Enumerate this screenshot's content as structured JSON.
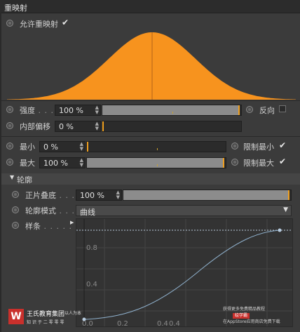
{
  "panel": {
    "title": "重映射"
  },
  "remap": {
    "enable_label": "允许重映射",
    "enabled": true
  },
  "strength": {
    "label": "强度",
    "value": "100 %",
    "fraction": 1.0,
    "invert_label": "反向",
    "inverted": false
  },
  "inner_offset": {
    "label": "内部偏移",
    "value": "0 %",
    "fraction": 0.0
  },
  "min": {
    "label": "最小",
    "value": "0 %",
    "fraction": 0.0,
    "clamp_label": "限制最小",
    "clamp": true
  },
  "max": {
    "label": "最大",
    "value": "100 %",
    "fraction": 1.0,
    "clamp_label": "限制最大",
    "clamp": true
  },
  "contour": {
    "group_label": "轮廓",
    "overlay_label": "正片叠底",
    "overlay_value": "100 %",
    "overlay_fraction": 1.0,
    "mode_label": "轮廓模式",
    "mode_value": "曲线",
    "spline_label": "样条",
    "spline_y_ticks": [
      "0.8",
      "0.4"
    ],
    "spline_x_ticks": [
      "0.0",
      "0.2",
      "0.4"
    ],
    "spline_x_tick2": "0.4"
  },
  "watermark": {
    "brand": "王氏教育集团",
    "brand_small": "以人为本",
    "slogan": "知 识 于 二 零 零 零",
    "right_line1": "获得更多免费精品教程",
    "right_badge": "绘学霸",
    "right_line2": "在AppStore应用商店免费下载"
  },
  "colors": {
    "accent": "#f0a020",
    "curve_fill": "#f7931e",
    "spline": "#8fb0cc"
  }
}
